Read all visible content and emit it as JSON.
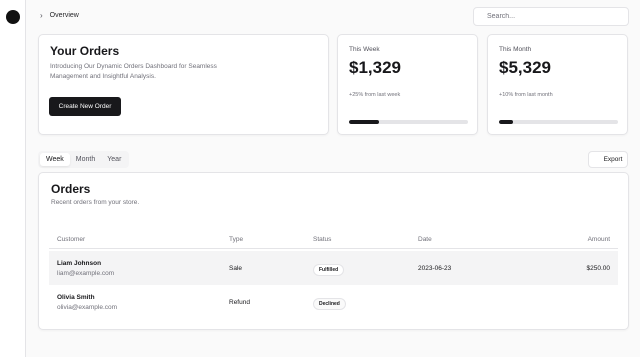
{
  "breadcrumb": {
    "label": "Overview"
  },
  "search": {
    "placeholder": "Search..."
  },
  "hero": {
    "title": "Your Orders",
    "description": "Introducing Our Dynamic Orders Dashboard for Seamless Management and Insightful Analysis.",
    "button_label": "Create New Order"
  },
  "stats": [
    {
      "label": "This Week",
      "value": "$1,329",
      "note": "+25% from last week",
      "progress_percent": 25
    },
    {
      "label": "This Month",
      "value": "$5,329",
      "note": "+10% from last month",
      "progress_percent": 12
    }
  ],
  "tabs": [
    {
      "label": "Week",
      "active": true
    },
    {
      "label": "Month",
      "active": false
    },
    {
      "label": "Year",
      "active": false
    }
  ],
  "export_label": "Export",
  "orders": {
    "title": "Orders",
    "subtitle": "Recent orders from your store.",
    "columns": {
      "customer": "Customer",
      "type": "Type",
      "status": "Status",
      "date": "Date",
      "amount": "Amount"
    },
    "rows": [
      {
        "name": "Liam Johnson",
        "email": "liam@example.com",
        "type": "Sale",
        "status": "Fulfilled",
        "date": "2023-06-23",
        "amount": "$250.00"
      },
      {
        "name": "Olivia Smith",
        "email": "olivia@example.com",
        "type": "Refund",
        "status": "Declined",
        "date": "",
        "amount": ""
      }
    ]
  },
  "colors": {
    "primary": "#18181b",
    "border": "#e4e4e7",
    "muted_text": "#71717a",
    "background": "#fafafa"
  }
}
